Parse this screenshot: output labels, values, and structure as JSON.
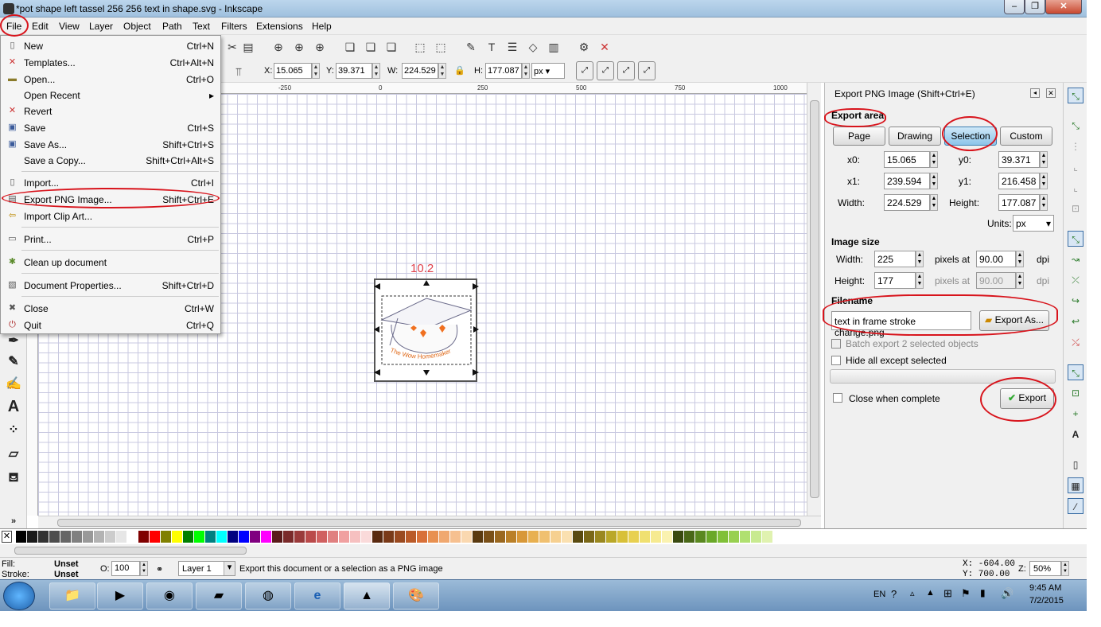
{
  "window": {
    "title": "*pot shape left tassel 256 256 text in shape.svg - Inkscape"
  },
  "menubar": [
    "File",
    "Edit",
    "View",
    "Layer",
    "Object",
    "Path",
    "Text",
    "Filters",
    "Extensions",
    "Help"
  ],
  "file_menu": [
    {
      "label": "New",
      "shortcut": "Ctrl+N"
    },
    {
      "label": "Templates...",
      "shortcut": "Ctrl+Alt+N"
    },
    {
      "label": "Open...",
      "shortcut": "Ctrl+O"
    },
    {
      "label": "Open Recent",
      "shortcut": "▸"
    },
    {
      "label": "Revert",
      "shortcut": ""
    },
    {
      "label": "Save",
      "shortcut": "Ctrl+S"
    },
    {
      "label": "Save As...",
      "shortcut": "Shift+Ctrl+S"
    },
    {
      "label": "Save a Copy...",
      "shortcut": "Shift+Ctrl+Alt+S"
    },
    {
      "label": "Import...",
      "shortcut": "Ctrl+I"
    },
    {
      "label": "Export PNG Image...",
      "shortcut": "Shift+Ctrl+E"
    },
    {
      "label": "Import Clip Art...",
      "shortcut": ""
    },
    {
      "label": "Print...",
      "shortcut": "Ctrl+P"
    },
    {
      "label": "Clean up document",
      "shortcut": ""
    },
    {
      "label": "Document Properties...",
      "shortcut": "Shift+Ctrl+D"
    },
    {
      "label": "Close",
      "shortcut": "Ctrl+W"
    },
    {
      "label": "Quit",
      "shortcut": "Ctrl+Q"
    }
  ],
  "select_toolbar": {
    "x_label": "X:",
    "x": "15.065",
    "y_label": "Y:",
    "y": "39.371",
    "w_label": "W:",
    "w": "224.529",
    "h_label": "H:",
    "h": "177.087",
    "unit": "px"
  },
  "ruler": {
    "h_ticks": [
      "-250",
      "0",
      "250",
      "500",
      "750",
      "1000"
    ]
  },
  "canvas": {
    "measure_label": "10.2",
    "artwork_text": "The Wow Homemaker"
  },
  "export_panel": {
    "title": "Export PNG Image (Shift+Ctrl+E)",
    "export_area_label": "Export area",
    "area_buttons": [
      "Page",
      "Drawing",
      "Selection",
      "Custom"
    ],
    "selected_area": "Selection",
    "x0_label": "x0:",
    "x0": "15.065",
    "y0_label": "y0:",
    "y0": "39.371",
    "x1_label": "x1:",
    "x1": "239.594",
    "y1_label": "y1:",
    "y1": "216.458",
    "width_label": "Width:",
    "width": "224.529",
    "height_label": "Height:",
    "height": "177.087",
    "units_label": "Units:",
    "units": "px",
    "image_size_label": "Image size",
    "img_width_label": "Width:",
    "img_width": "225",
    "img_height_label": "Height:",
    "img_height": "177",
    "pixels_at": "pixels at",
    "dpi_x": "90.00",
    "dpi_y": "90.00",
    "dpi_label": "dpi",
    "filename_label": "Filename",
    "filename": "text in frame stroke change.png",
    "export_as_label": "Export As...",
    "batch_label": "Batch export 2 selected objects",
    "hide_label": "Hide all except selected",
    "close_when_complete_label": "Close when complete",
    "export_label": "Export"
  },
  "statusbar": {
    "fill_label": "Fill:",
    "fill_value": "Unset",
    "stroke_label": "Stroke:",
    "stroke_value": "Unset",
    "opacity_label": "O:",
    "opacity": "100",
    "layer": "Layer 1",
    "message": "Export this document or a selection as a PNG image",
    "coord_x": "X: -604.00",
    "coord_y": "Y: 700.00",
    "zoom_label": "Z:",
    "zoom": "50%"
  },
  "taskbar": {
    "lang": "EN",
    "time": "9:45 AM",
    "date": "7/2/2015"
  },
  "colors": {
    "selection_button": "#8cc5ea",
    "annotation": "#d8141c",
    "measure": "#e0404a"
  }
}
